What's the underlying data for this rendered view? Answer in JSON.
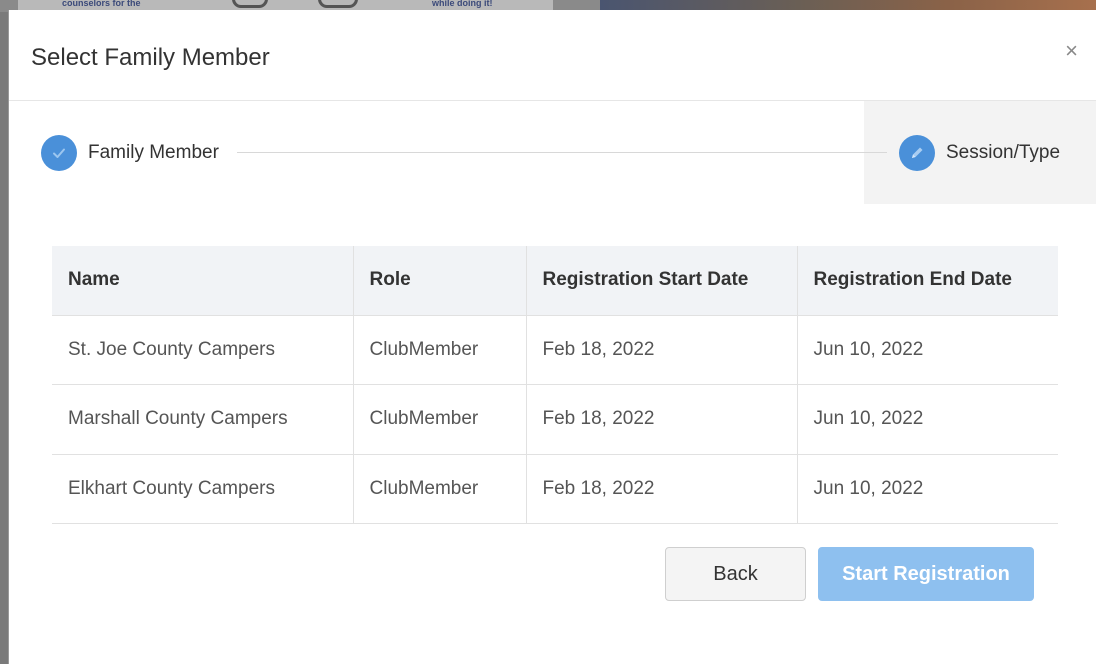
{
  "background": {
    "text_left": "counselors for the",
    "text_right": "while doing it!"
  },
  "modal": {
    "title": "Select Family Member",
    "close_symbol": "×"
  },
  "stepper": {
    "steps": [
      {
        "label": "Family Member",
        "state": "completed",
        "icon": "check-icon"
      },
      {
        "label": "Session/Type",
        "state": "active",
        "icon": "pencil-icon"
      }
    ]
  },
  "table": {
    "headers": [
      "Name",
      "Role",
      "Registration Start Date",
      "Registration End Date"
    ],
    "rows": [
      [
        "St. Joe County Campers",
        "ClubMember",
        "Feb 18, 2022",
        "Jun 10, 2022"
      ],
      [
        "Marshall County Campers",
        "ClubMember",
        "Feb 18, 2022",
        "Jun 10, 2022"
      ],
      [
        "Elkhart County Campers",
        "ClubMember",
        "Feb 18, 2022",
        "Jun 10, 2022"
      ]
    ]
  },
  "actions": {
    "back_label": "Back",
    "start_label": "Start Registration"
  },
  "colors": {
    "accent": "#4a90d9",
    "primary_button_disabled": "#8ec0ef",
    "header_bg": "#f1f3f6"
  }
}
